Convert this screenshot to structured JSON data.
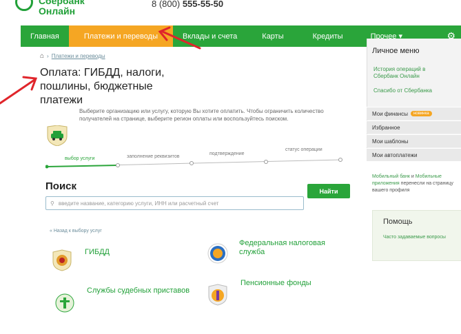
{
  "header": {
    "logo_line1": "Сбербанк",
    "logo_line2": "Онлайн",
    "phone_prefix": "8 (800)",
    "phone_number": "555-55-50"
  },
  "nav": {
    "items": [
      "Главная",
      "Платежи и переводы",
      "Вклады и счета",
      "Карты",
      "Кредиты",
      "Прочее ▾"
    ],
    "active_index": 1
  },
  "breadcrumb": {
    "current": "Платежи и переводы"
  },
  "page": {
    "title": "Оплата: ГИБДД, налоги, пошлины, бюджетные платежи",
    "description": "Выберите организацию или услугу, которую Вы хотите оплатить. Чтобы ограничить количество получателей на странице, выберите регион оплаты или воспользуйтесь поиском."
  },
  "steps": [
    "выбор услуги",
    "заполнение реквизитов",
    "подтверждение",
    "статус операции"
  ],
  "search": {
    "title": "Поиск",
    "placeholder": "введите название, категорию услуги, ИНН или расчетный счет",
    "button": "Найти"
  },
  "back_link": "« Назад к выбору услуг",
  "services": [
    "ГИБДД",
    "Федеральная налоговая служба",
    "Службы судебных приставов",
    "Пенсионные фонды"
  ],
  "sidebar": {
    "title": "Личное меню",
    "links": [
      "История операций в Сбербанк Онлайн",
      "Спасибо от Сбербанка"
    ],
    "rows": [
      "Мои финансы",
      "Избранное",
      "Мои шаблоны",
      "Мои автоплатежи"
    ],
    "badge": "новинка",
    "note_part1": "Мобильный банк",
    "note_part2": " и ",
    "note_part3": "Мобильные приложения",
    "note_part4": " перенесли на страницу вашего профиля"
  },
  "help": {
    "title": "Помощь",
    "link": "Часто задаваемые вопросы"
  },
  "colors": {
    "brand_green": "#2aa53a",
    "active_orange": "#f5a623",
    "arrow_red": "#e0252b"
  }
}
